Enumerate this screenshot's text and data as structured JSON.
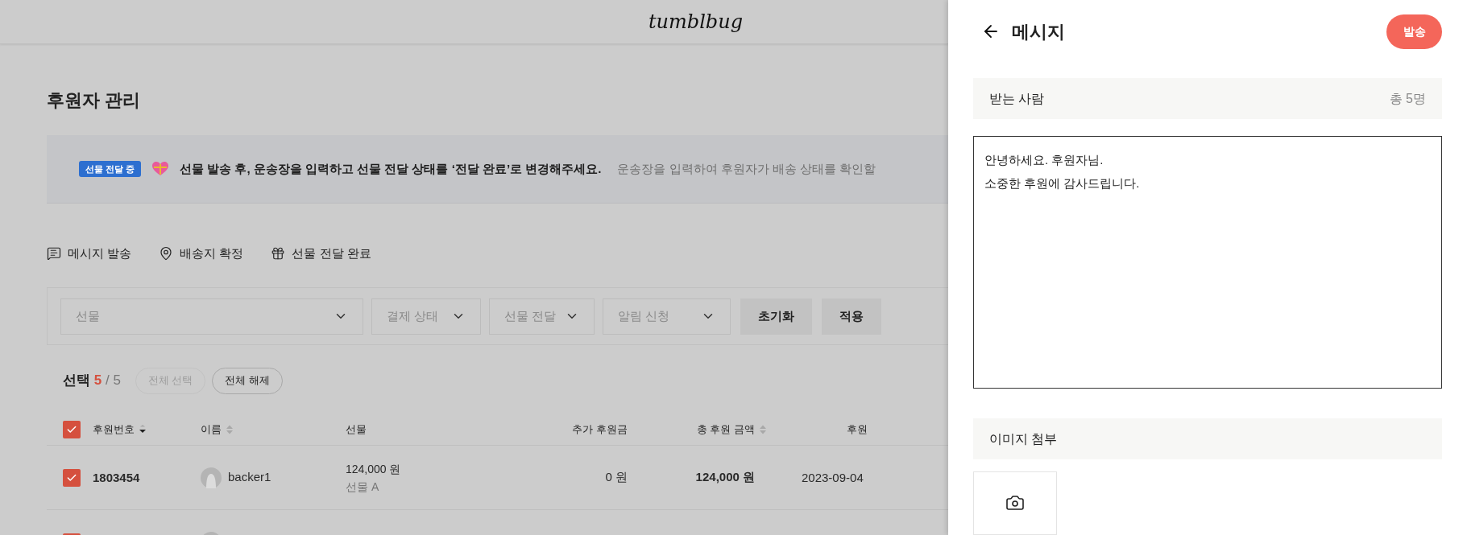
{
  "header": {
    "logo": "tumblbug"
  },
  "page_title": "후원자 관리",
  "notice": {
    "badge": "선물 전달 중",
    "message": "선물 발송 후, 운송장을 입력하고 선물 전달 상태를 ‘전달 완료’로 변경해주세요.",
    "hint": "운송장을 입력하여 후원자가 배송 상태를 확인할"
  },
  "actions": [
    {
      "kind": "message",
      "label": "메시지 발송"
    },
    {
      "kind": "location",
      "label": "배송지 확정"
    },
    {
      "kind": "gift",
      "label": "선물 전달 완료"
    }
  ],
  "filters": {
    "selects": [
      {
        "placeholder": "선물"
      },
      {
        "placeholder": "결제 상태"
      },
      {
        "placeholder": "선물 전달"
      },
      {
        "placeholder": "알림 신청"
      }
    ],
    "buttons": [
      "초기화",
      "적용"
    ]
  },
  "selection": {
    "label": "선택",
    "count": "5",
    "total": "/ 5",
    "buttons": [
      {
        "label": "전체 선택",
        "disabled": true
      },
      {
        "label": "전체 해제",
        "disabled": false
      }
    ]
  },
  "table": {
    "all_checked": true,
    "columns": [
      {
        "label": "후원번호",
        "sorted": true
      },
      {
        "label": "이름",
        "sorted": false
      },
      {
        "label": "선물"
      },
      {
        "label": "추가 후원금"
      },
      {
        "label": "총 후원 금액",
        "sorted": false
      },
      {
        "label": "후원"
      }
    ],
    "rows": [
      {
        "checked": true,
        "id": "1803454",
        "name": "backer1",
        "amount": "124,000 원",
        "reward": "선물 A",
        "extra": "0 원",
        "total": "124,000 원",
        "date": "2023-09-04"
      },
      {
        "checked": true
      }
    ]
  },
  "panel": {
    "title": "메시지",
    "send_button": "발송",
    "recipients": {
      "label": "받는 사람",
      "count": "총 5명"
    },
    "message": "안녕하세요. 후원자님.\n소중한 후원에 감사드립니다.",
    "attachment": {
      "label": "이미지 첨부"
    }
  }
}
